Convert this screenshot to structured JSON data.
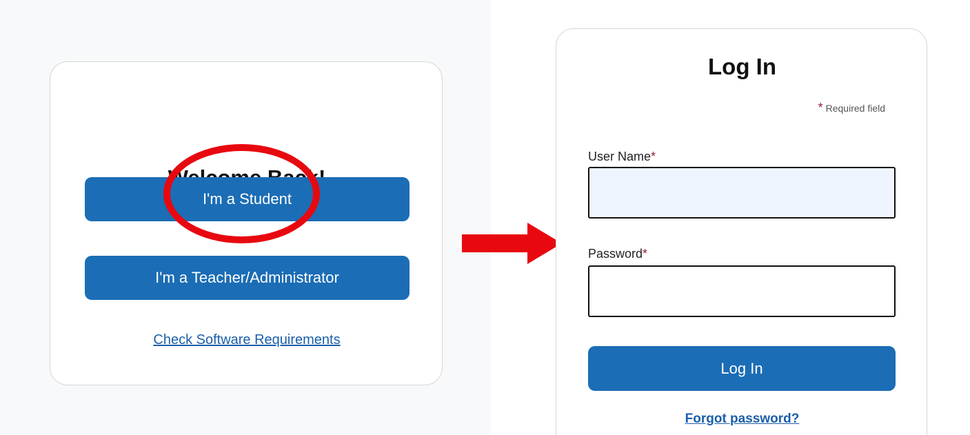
{
  "welcome_card": {
    "title": "Welcome Back!",
    "student_button": "I'm a Student",
    "teacher_button": "I'm a Teacher/Administrator",
    "software_link": "Check Software Requirements"
  },
  "login_card": {
    "title": "Log In",
    "required_star": "*",
    "required_note": "Required field",
    "username_label": "User Name",
    "password_label": "Password",
    "label_star": "*",
    "username_value": "",
    "password_value": "",
    "login_button": "Log In",
    "forgot_link": "Forgot password?"
  },
  "annotations": {
    "highlight_color": "#e8080f",
    "arrow_color": "#e8080f",
    "arrow_icon": "arrow-right-icon"
  },
  "colors": {
    "primary_button": "#1b6db5",
    "link": "#1b5fa8",
    "required_star": "#9b1b30"
  }
}
